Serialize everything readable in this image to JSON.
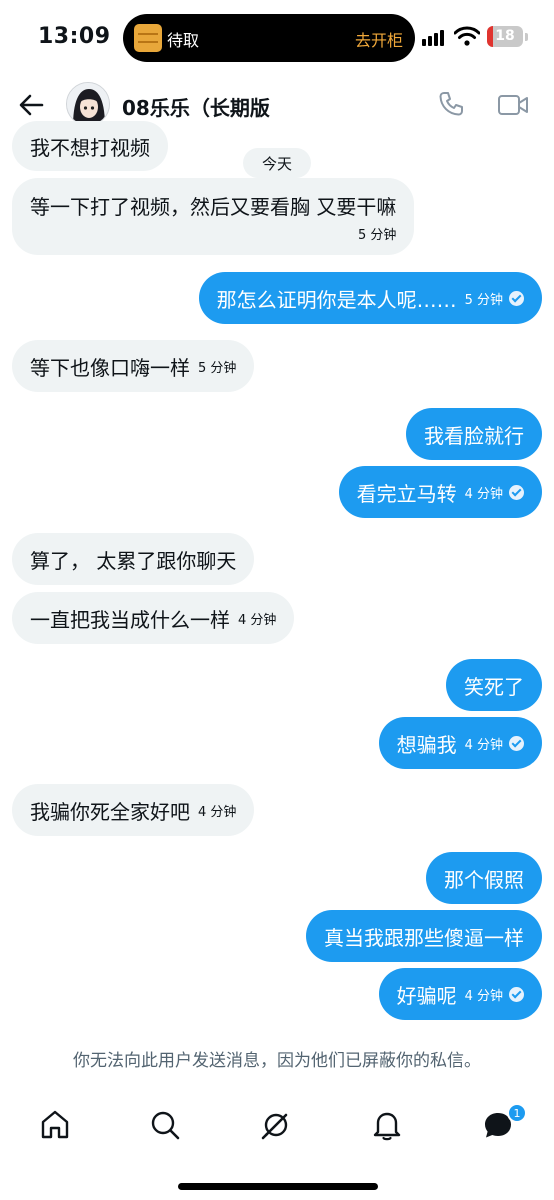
{
  "status_bar": {
    "time": "13:09",
    "island_left": "待取",
    "island_right": "去开柜",
    "battery": "18",
    "battery_level": 0.18
  },
  "header": {
    "contact_name": "08乐乐（长期版"
  },
  "date_divider": "今天",
  "messages": [
    {
      "dir": "in",
      "text": "我不想打视频",
      "time": ""
    },
    {
      "dir": "in",
      "text": "等一下打了视频，然后又要看胸 又要干嘛",
      "time": "5 分钟"
    },
    {
      "dir": "out",
      "text": "那怎么证明你是本人呢……",
      "time": "5 分钟",
      "read": true
    },
    {
      "dir": "in",
      "text": "等下也像口嗨一样",
      "time": "5 分钟"
    },
    {
      "dir": "out",
      "text": "我看脸就行",
      "time": ""
    },
    {
      "dir": "out",
      "text": "看完立马转",
      "time": "4 分钟",
      "read": true
    },
    {
      "dir": "in",
      "text": "算了， 太累了跟你聊天",
      "time": ""
    },
    {
      "dir": "in",
      "text": "一直把我当成什么一样",
      "time": "4 分钟"
    },
    {
      "dir": "out",
      "text": "笑死了",
      "time": ""
    },
    {
      "dir": "out",
      "text": "想骗我",
      "time": "4 分钟",
      "read": true
    },
    {
      "dir": "in",
      "text": "我骗你死全家好吧",
      "time": "4 分钟"
    },
    {
      "dir": "out",
      "text": "那个假照",
      "time": ""
    },
    {
      "dir": "out",
      "text": "真当我跟那些傻逼一样",
      "time": ""
    },
    {
      "dir": "out",
      "text": "好骗呢",
      "time": "4 分钟",
      "read": true
    }
  ],
  "notice": "你无法向此用户发送消息，因为他们已屏蔽你的私信。",
  "bottom_nav": {
    "items": [
      "home-icon",
      "search-icon",
      "grok-icon",
      "bell-icon",
      "messages-icon"
    ],
    "messages_badge": "1"
  },
  "colors": {
    "accent": "#1d9bf0",
    "incoming_bubble": "#eff3f4",
    "text": "#0f1419",
    "muted": "#536471"
  }
}
